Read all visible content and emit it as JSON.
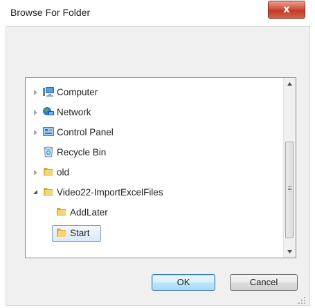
{
  "window": {
    "title": "Browse For Folder",
    "close_glyph": "x"
  },
  "tree": {
    "items": [
      {
        "label": "Computer",
        "icon": "computer-icon",
        "expander": "collapsed"
      },
      {
        "label": "Network",
        "icon": "network-icon",
        "expander": "collapsed"
      },
      {
        "label": "Control Panel",
        "icon": "control-panel-icon",
        "expander": "collapsed"
      },
      {
        "label": "Recycle Bin",
        "icon": "recycle-bin-icon",
        "expander": "none"
      },
      {
        "label": "old",
        "icon": "folder-icon",
        "expander": "collapsed"
      },
      {
        "label": "Video22-ImportExcelFiles",
        "icon": "folder-icon",
        "expander": "expanded"
      },
      {
        "label": "AddLater",
        "icon": "folder-icon",
        "expander": "none"
      },
      {
        "label": "Start",
        "icon": "folder-icon",
        "expander": "none",
        "selected": true
      }
    ]
  },
  "buttons": {
    "ok_label": "OK",
    "cancel_label": "Cancel"
  },
  "colors": {
    "close_button": "#c73a24",
    "selection_border": "#7da2ce",
    "default_button_border": "#3c7fb1",
    "folder": "#e8c35a"
  }
}
